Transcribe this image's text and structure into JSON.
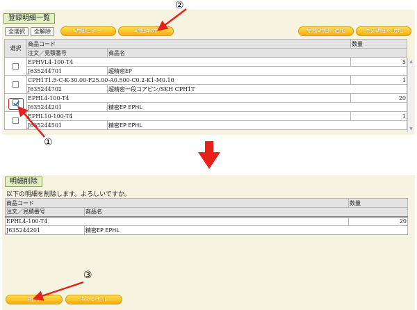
{
  "markers": {
    "one": "①",
    "two": "②",
    "three": "③"
  },
  "top": {
    "title": "登録明細一覧",
    "buttons": {
      "select_all": "全選択",
      "clear_all": "全解除",
      "copy": "明細コピー",
      "delete": "明細削除",
      "add_estimate": "見積明細へ追加",
      "add_order": "注文明細へ追加"
    },
    "headers": {
      "select": "選択",
      "product_code": "商品コード",
      "quantity": "数量",
      "order_estimate_no": "注文／見積番号",
      "product_name": "商品名"
    },
    "rows": [
      {
        "code": "EPHVL4-100-T4",
        "qty": "5",
        "order_no": "J635244701",
        "name": "超精密EP",
        "checked": false
      },
      {
        "code": "CPH1T1.5-C-K-30.00-F25.00-A0.500-C0.2-K1-M0.10",
        "qty": "1",
        "order_no": "J635244702",
        "name": "超精密一段コアピン/SKH CPH1T",
        "checked": false
      },
      {
        "code": "EPHL4-100-T4",
        "qty": "20",
        "order_no": "J635244201",
        "name": "精密EP EPHL",
        "checked": true
      },
      {
        "code": "EPHL10-100-T4",
        "qty": "1",
        "order_no": "J635244501",
        "name": "精密EP EPHL",
        "checked": false
      }
    ]
  },
  "bottom": {
    "title": "明細削除",
    "message": "以下の明細を削除します。よろしいですか。",
    "headers": {
      "product_code": "商品コード",
      "quantity": "数量",
      "order_estimate_no": "注文／見積番号",
      "product_name": "商品名"
    },
    "row": {
      "code": "EPHL4-100-T4",
      "qty": "20",
      "order_no": "J635244201",
      "name": "精密EP EPHL"
    },
    "buttons": {
      "delete": "削 除",
      "cancel": "キャンセル"
    }
  },
  "colors": {
    "panel_bg": "#f6f3e0",
    "accent_orange": "#f5ae10",
    "arrow_red": "#e8201a",
    "title_green": "#e4f0c4"
  }
}
